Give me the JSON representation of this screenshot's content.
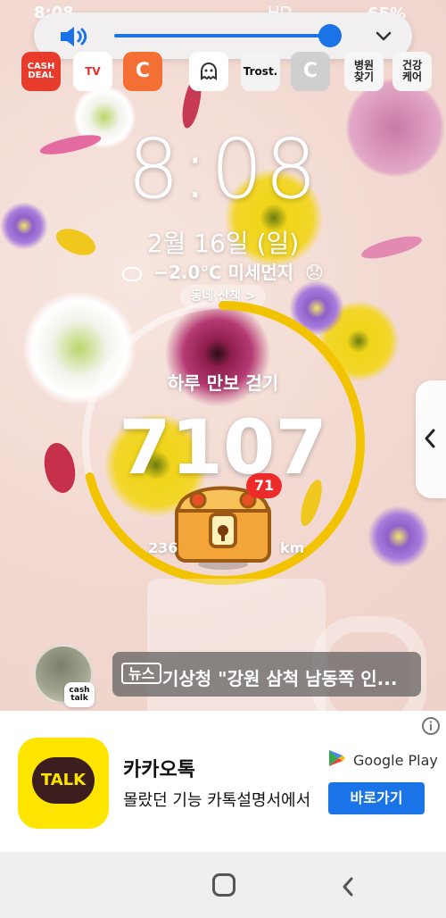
{
  "status_bar": {
    "time": "8:08",
    "battery": "65%",
    "icons_text": "HD"
  },
  "volume_panel": {
    "level": 0.96
  },
  "apps": [
    {
      "label": "CASH\nDEAL"
    },
    {
      "label": "TV"
    },
    {
      "label": "C"
    },
    {
      "label": ""
    },
    {
      "label": "Trost."
    },
    {
      "label": "C"
    },
    {
      "label": "병원\n찾기"
    },
    {
      "label": "건강\n케어"
    }
  ],
  "clock": {
    "time": "8:08",
    "date": "2월 16일 (일)"
  },
  "weather": {
    "text": "−2.0℃ 미세먼지",
    "emoji": "😞"
  },
  "walk_chip": {
    "label": "동네 산책  >"
  },
  "step_ring": {
    "label": "하루 만보 걷기",
    "steps": "7107",
    "badge": "71",
    "dist_left": "236",
    "dist_right": "km",
    "progress": 0.71
  },
  "news": {
    "tag": "뉴스",
    "headline": "기상청 \"강원 삼척 남동쪽 인..."
  },
  "cash_talk": {
    "text": "cash\ntalk"
  },
  "ad": {
    "app_icon_text": "TALK",
    "title": "카카오톡",
    "desc": "몰랐던 기능 카톡설명서에서",
    "store": "Google Play",
    "cta": "바로가기"
  },
  "colors": {
    "accent_blue": "#1b73e8",
    "ring_yellow": "#f2c300",
    "kakao_yellow": "#fee500"
  },
  "icons": [
    "speaker-icon",
    "chevron-down-icon",
    "cloud-icon",
    "chevron-left-icon",
    "info-icon",
    "home-button-icon",
    "back-icon"
  ]
}
